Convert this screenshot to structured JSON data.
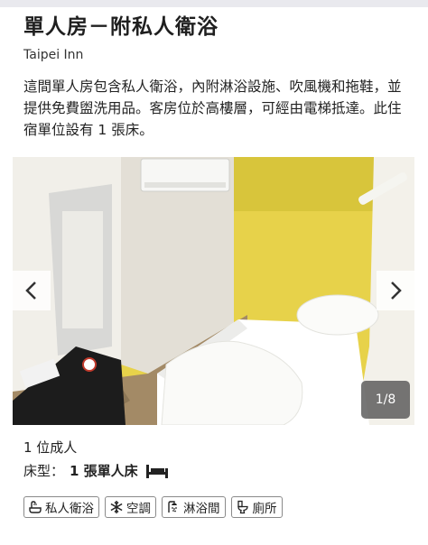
{
  "room": {
    "title": "單人房－附私人衛浴",
    "hotel": "Taipei Inn",
    "description": "這間單人房包含私人衛浴，內附淋浴設施、吹風機和拖鞋，並提供免費盥洗用品。客房位於高樓層，可經由電梯抵達。此住宿單位設有 1 張床。"
  },
  "gallery": {
    "counter": "1/8",
    "prev_icon": "chevron-left-icon",
    "next_icon": "chevron-right-icon"
  },
  "details": {
    "occupancy": "1 位成人",
    "bed_label": "床型：",
    "bed_value": "1 張單人床",
    "bed_icon": "single-bed-icon"
  },
  "amenities": [
    {
      "label": "私人衛浴",
      "icon": "bathroom-icon"
    },
    {
      "label": "空調",
      "icon": "snowflake-icon"
    },
    {
      "label": "淋浴間",
      "icon": "shower-icon"
    },
    {
      "label": "廁所",
      "icon": "toilet-icon"
    }
  ]
}
